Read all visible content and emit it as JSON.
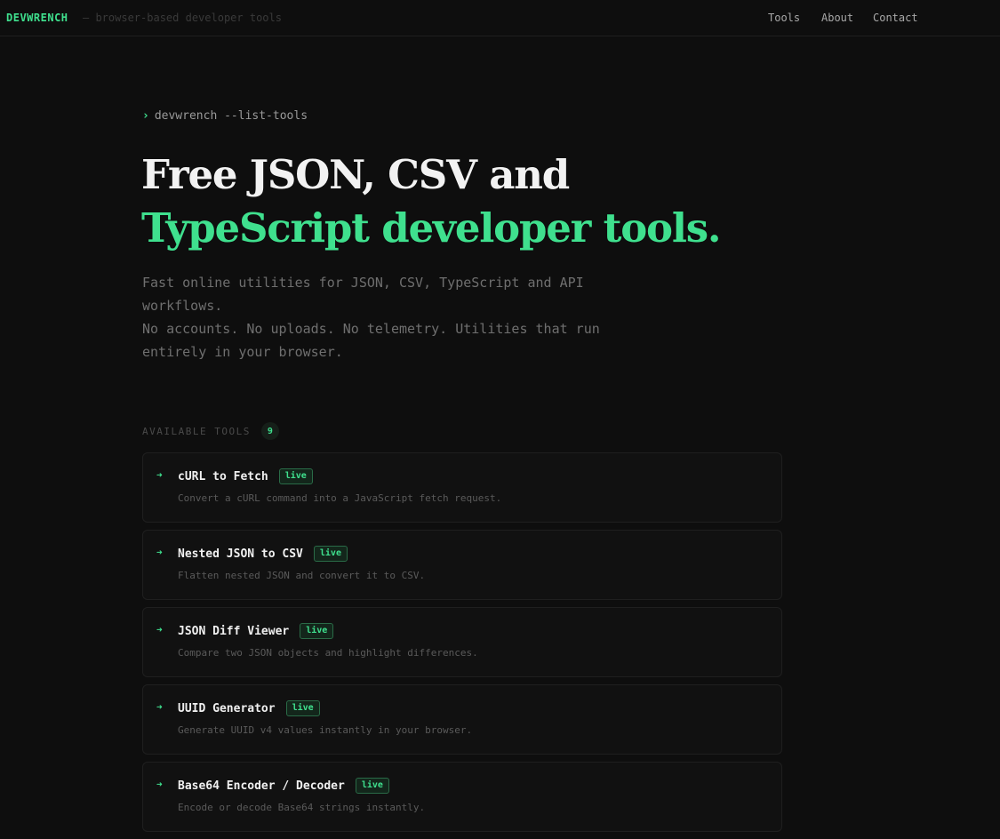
{
  "header": {
    "brand": "DEVWRENCH",
    "tagline": "— browser-based developer tools",
    "nav": {
      "tools": "Tools",
      "about": "About",
      "contact": "Contact"
    }
  },
  "hero": {
    "prompt_caret": "›",
    "prompt": "devwrench --list-tools",
    "headline_line1": "Free JSON, CSV and",
    "headline_line2": "TypeScript developer tools.",
    "desc_line1": "Fast online utilities for JSON, CSV, TypeScript and API workflows.",
    "desc_line2": "No accounts. No uploads. No telemetry. Utilities that run entirely in your browser."
  },
  "tools_section": {
    "label": "AVAILABLE TOOLS",
    "count": "9",
    "arrow_icon": "arrow-right-icon",
    "accent_color": "#3fe08e",
    "items": [
      {
        "name": "cURL to Fetch",
        "badge": "live",
        "description": "Convert a cURL command into a JavaScript fetch request."
      },
      {
        "name": "Nested JSON to CSV",
        "badge": "live",
        "description": "Flatten nested JSON and convert it to CSV."
      },
      {
        "name": "JSON Diff Viewer",
        "badge": "live",
        "description": "Compare two JSON objects and highlight differences."
      },
      {
        "name": "UUID Generator",
        "badge": "live",
        "description": "Generate UUID v4 values instantly in your browser."
      },
      {
        "name": "Base64 Encoder / Decoder",
        "badge": "live",
        "description": "Encode or decode Base64 strings instantly."
      }
    ]
  }
}
